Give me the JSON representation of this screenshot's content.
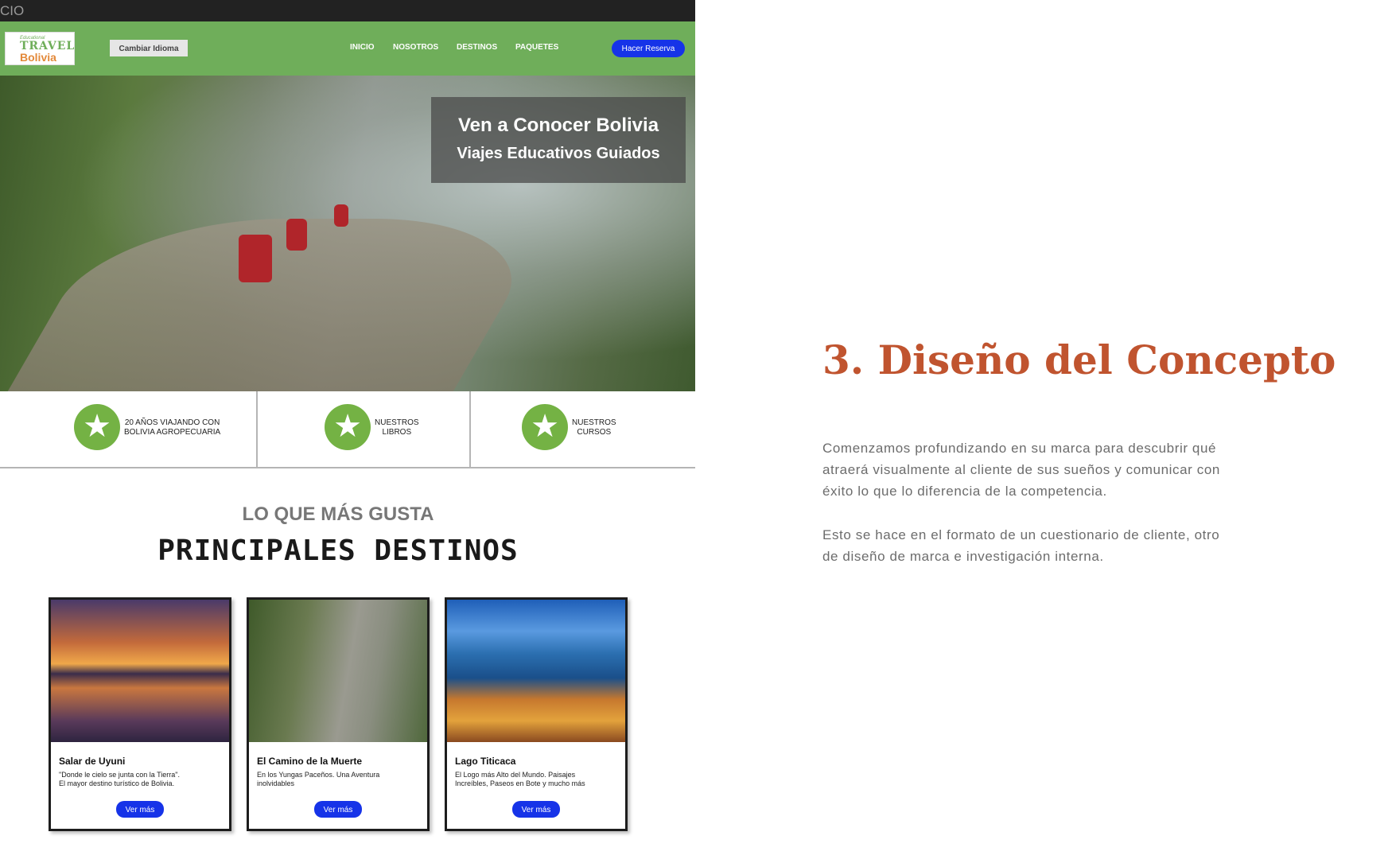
{
  "topbar": {
    "text": "CIO"
  },
  "nav": {
    "logo": {
      "line1": "Educational",
      "line2": "TRAVEL",
      "line3": "Bolivia"
    },
    "language_button": "Cambiar Idioma",
    "links": [
      "INICIO",
      "NOSOTROS",
      "DESTINOS",
      "PAQUETES"
    ],
    "reserve_button": "Hacer Reserva"
  },
  "hero": {
    "title": "Ven a Conocer Bolivia",
    "subtitle": "Viajes Educativos Guiados"
  },
  "features": [
    {
      "line1": "20 AÑOS VIAJANDO CON",
      "line2": "BOLIVIA AGROPECUARIA"
    },
    {
      "line1": "NUESTROS",
      "line2": "LIBROS"
    },
    {
      "line1": "NUESTROS",
      "line2": "CURSOS"
    }
  ],
  "section": {
    "supertitle": "LO QUE MÁS GUSTA",
    "title": "PRINCIPALES DESTINOS"
  },
  "cards": [
    {
      "title": "Salar de Uyuni",
      "desc1": "\"Donde le cielo se junta con la Tierra\".",
      "desc2": "El mayor destino turístico de Bolivia.",
      "button": "Ver más"
    },
    {
      "title": "El Camino de la Muerte",
      "desc1": "En los Yungas Paceños. Una Aventura",
      "desc2": "inolvidables",
      "button": "Ver más"
    },
    {
      "title": "Lago Titicaca",
      "desc1": "El Logo más Alto del Mundo. Paisajes",
      "desc2": "Increíbles, Paseos en Bote y mucho más",
      "button": "Ver más"
    }
  ],
  "concept": {
    "heading": "3. Diseño del Concepto",
    "paragraph1_lines": [
      "Comenzamos profundizando en su marca para descubrir qué",
      "atraerá visualmente al cliente de sus sueños y comunicar con",
      "éxito lo que lo diferencia de la competencia."
    ],
    "paragraph2_lines": [
      "Esto se hace en el formato de un cuestionario de cliente, otro",
      "de diseño de marca e investigación interna."
    ]
  },
  "colors": {
    "nav_green": "#6fae5a",
    "button_blue": "#1633e8",
    "star_green": "#74b244",
    "heading_orange": "#c0542f"
  },
  "icons": [
    "star-icon"
  ]
}
